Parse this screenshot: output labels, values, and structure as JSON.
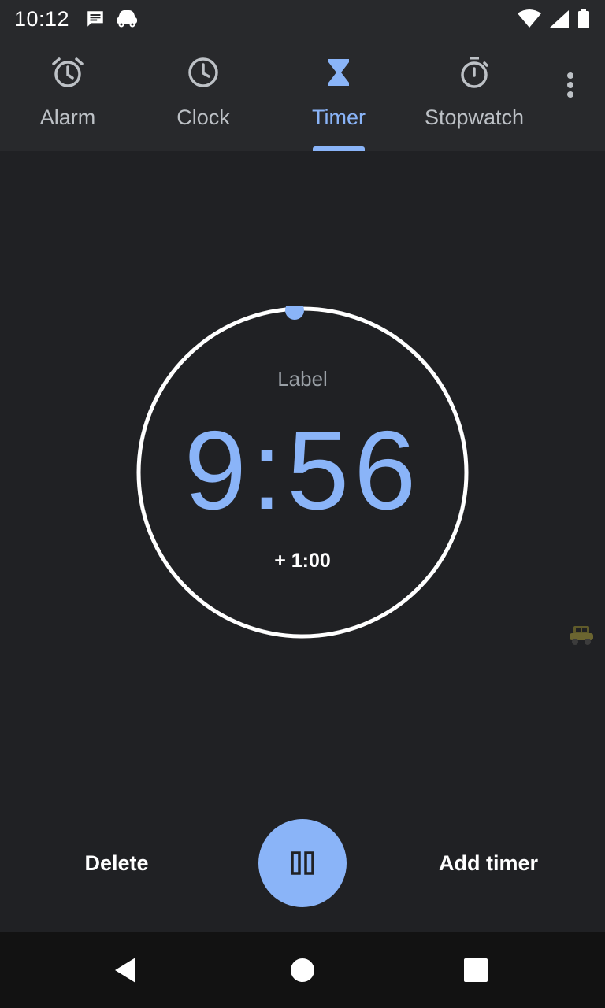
{
  "status_bar": {
    "time": "10:12",
    "icons": [
      "message-icon",
      "car-icon",
      "wifi-icon",
      "signal-icon",
      "battery-icon"
    ]
  },
  "tabs": [
    {
      "label": "Alarm",
      "icon": "alarm-icon",
      "active": false
    },
    {
      "label": "Clock",
      "icon": "clock-icon",
      "active": false
    },
    {
      "label": "Timer",
      "icon": "hourglass-icon",
      "active": true
    },
    {
      "label": "Stopwatch",
      "icon": "stopwatch-icon",
      "active": false
    }
  ],
  "timer": {
    "label": "Label",
    "time": "9:56",
    "add_minute": "+ 1:00"
  },
  "actions": {
    "delete": "Delete",
    "add_timer": "Add timer",
    "pause_icon": "pause-icon"
  },
  "colors": {
    "accent": "#8ab4f8",
    "background": "#202124",
    "bar": "#28292c"
  }
}
